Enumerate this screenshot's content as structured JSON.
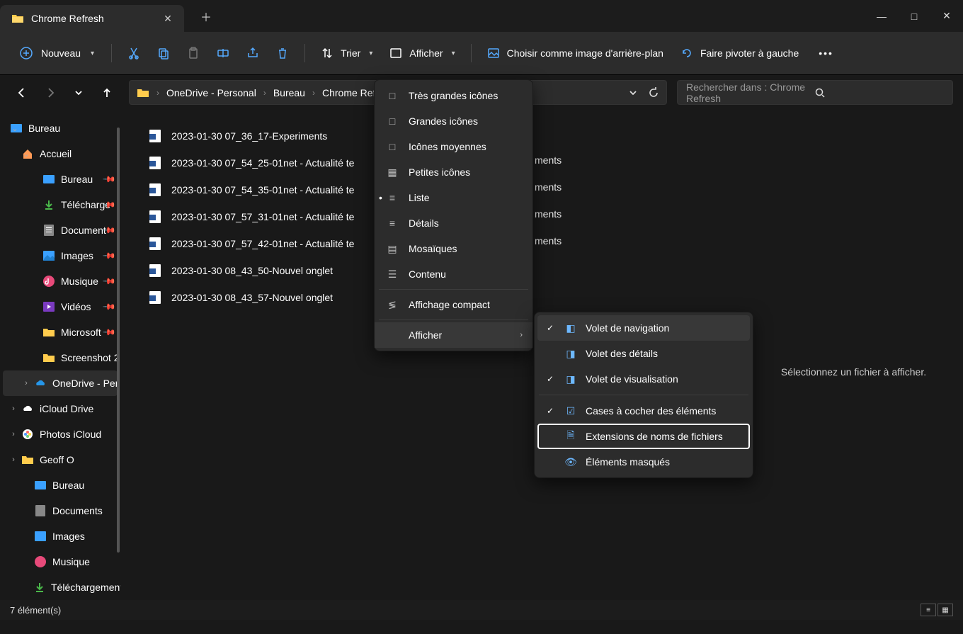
{
  "window": {
    "tab_title": "Chrome Refresh",
    "controls": {
      "minimize": "—",
      "maximize": "□",
      "close": "✕"
    }
  },
  "toolbar": {
    "nouveau": "Nouveau",
    "trier": "Trier",
    "afficher": "Afficher",
    "wallpaper": "Choisir comme image d'arrière-plan",
    "rotate": "Faire pivoter à gauche"
  },
  "breadcrumbs": [
    "OneDrive - Personal",
    "Bureau",
    "Chrome Refresh"
  ],
  "search_placeholder": "Rechercher dans : Chrome Refresh",
  "sidebar": {
    "top": "Bureau",
    "accueil": "Accueil",
    "quick": [
      "Bureau",
      "Télécharge",
      "Document",
      "Images",
      "Musique",
      "Vidéos",
      "Microsoft",
      "Screenshot 2"
    ],
    "onedrive": "OneDrive - Per",
    "below": [
      "iCloud Drive",
      "Photos iCloud",
      "Geoff O",
      "Bureau",
      "Documents",
      "Images",
      "Musique",
      "Téléchargement"
    ]
  },
  "files": [
    "2023-01-30 07_36_17-Experiments",
    "2023-01-30 07_54_25-01net - Actualité te",
    "2023-01-30 07_54_35-01net - Actualité te",
    "2023-01-30 07_57_31-01net - Actualité te",
    "2023-01-30 07_57_42-01net - Actualité te",
    "2023-01-30 08_43_50-Nouvel onglet",
    "2023-01-30 08_43_57-Nouvel onglet"
  ],
  "ghost_text": "ments",
  "preview_empty": "Sélectionnez un fichier à afficher.",
  "statusbar": "7 élément(s)",
  "view_menu": {
    "items": [
      "Très grandes icônes",
      "Grandes icônes",
      "Icônes moyennes",
      "Petites icônes",
      "Liste",
      "Détails",
      "Mosaïques",
      "Contenu"
    ],
    "compact": "Affichage compact",
    "show": "Afficher"
  },
  "show_menu": {
    "nav_pane": "Volet de navigation",
    "details_pane": "Volet des détails",
    "preview_pane": "Volet de visualisation",
    "checkboxes": "Cases à cocher des éléments",
    "extensions": "Extensions de noms de fichiers",
    "hidden": "Éléments masqués"
  }
}
